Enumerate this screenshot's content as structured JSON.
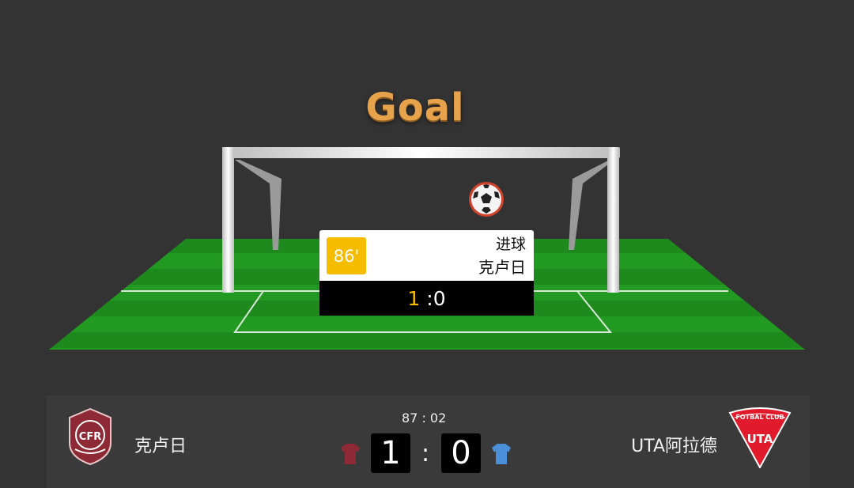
{
  "banner": {
    "title": "Goal"
  },
  "event": {
    "minute": "86'",
    "type": "进球",
    "team": "克卢日",
    "score_home": "1",
    "score_away": ":0"
  },
  "match": {
    "clock": "87 : 02",
    "home": {
      "name": "克卢日",
      "score": "1",
      "logo_text": "CFR",
      "jersey_color": "#8e2a36"
    },
    "away": {
      "name": "UTA阿拉德",
      "score": "0",
      "logo_text": "UTA",
      "logo_arc_text": "FOTBAL CLUB",
      "jersey_color": "#4a8fd8"
    },
    "separator": ":"
  },
  "colors": {
    "background": "#333333",
    "pitch": "#1f8f1f",
    "accent_gold": "#f5bc00",
    "title_gold": "#e7a24c"
  },
  "icons": [
    "soccer-ball-icon",
    "home-jersey-icon",
    "away-jersey-icon"
  ]
}
